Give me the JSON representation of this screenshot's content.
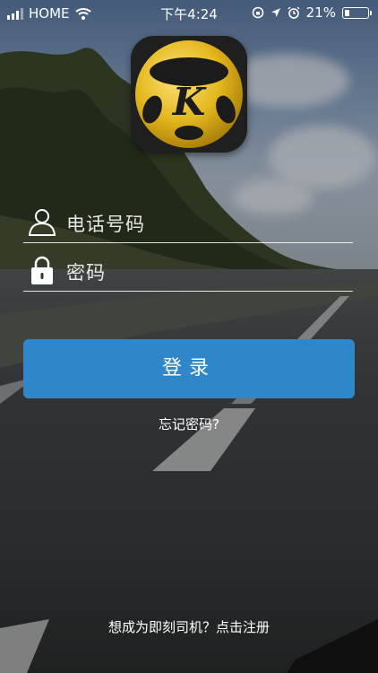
{
  "status_bar": {
    "carrier": "HOME",
    "time": "下午4:24",
    "battery_percent": "21%",
    "battery_level": 0.21,
    "icons": [
      "signal-icon",
      "wifi-icon",
      "rotation-lock-icon",
      "location-icon",
      "alarm-icon",
      "battery-icon"
    ]
  },
  "logo": {
    "icon": "steering-wheel-logo-icon",
    "letter": "K"
  },
  "form": {
    "phone_placeholder": "电话号码",
    "password_placeholder": "密码",
    "phone_icon": "user-icon",
    "password_icon": "lock-icon"
  },
  "actions": {
    "login_label": "登录",
    "forgot_password": "忘记密码?",
    "register_prompt": "想成为即刻司机？点击注册"
  },
  "colors": {
    "login_button": "#2f86c9",
    "logo_gold": "#e5b81e"
  }
}
